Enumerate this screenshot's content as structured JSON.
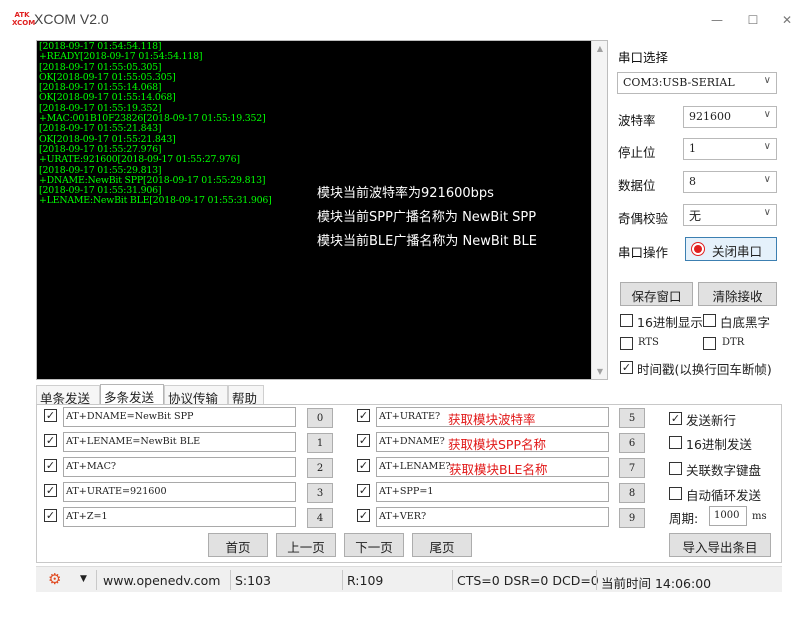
{
  "window": {
    "logo_text": "ATK\nXCOM",
    "title": "XCOM V2.0",
    "min_glyph": "—",
    "max_glyph": "☐",
    "close_glyph": "✕"
  },
  "terminal": {
    "lines": [
      "[2018-09-17 01:54:54.118]",
      "+READY[2018-09-17 01:54:54.118]",
      "[2018-09-17 01:55:05.305]",
      "OK[2018-09-17 01:55:05.305]",
      "[2018-09-17 01:55:14.068]",
      "OK[2018-09-17 01:55:14.068]",
      "[2018-09-17 01:55:19.352]",
      "+MAC:001B10F23826[2018-09-17 01:55:19.352]",
      "[2018-09-17 01:55:21.843]",
      "OK[2018-09-17 01:55:21.843]",
      "[2018-09-17 01:55:27.976]",
      "+URATE:921600[2018-09-17 01:55:27.976]",
      "[2018-09-17 01:55:29.813]",
      "+DNAME:NewBit SPP[2018-09-17 01:55:29.813]",
      "[2018-09-17 01:55:31.906]",
      "+LENAME:NewBit BLE[2018-09-17 01:55:31.906]"
    ],
    "annotations": [
      "模块当前波特率为921600bps",
      "模块当前SPP广播名称为 NewBit SPP",
      "模块当前BLE广播名称为 NewBit BLE"
    ],
    "scroll_up": "▲",
    "scroll_down": "▼"
  },
  "settings": {
    "port_label": "串口选择",
    "port_value": "COM3:USB-SERIAL",
    "baud_label": "波特率",
    "baud_value": "921600",
    "stop_label": "停止位",
    "stop_value": "1",
    "data_label": "数据位",
    "data_value": "8",
    "parity_label": "奇偶校验",
    "parity_value": "无",
    "op_label": "串口操作",
    "close_port_label": "关闭串口",
    "save_window_label": "保存窗口",
    "clear_recv_label": "清除接收",
    "hex_display_label": "16进制显示",
    "white_bg_label": "白底黑字",
    "rts_label": "RTS",
    "dtr_label": "DTR",
    "timestamp_label": "时间戳(以换行回车断帧)",
    "chevron": "∨",
    "checked": "✓",
    "unchecked": ""
  },
  "tabs": [
    "单条发送",
    "多条发送",
    "协议传输",
    "帮助"
  ],
  "multi_send": {
    "left": [
      {
        "text": "AT+DNAME=NewBit SPP",
        "num": "0"
      },
      {
        "text": "AT+LENAME=NewBit BLE",
        "num": "1"
      },
      {
        "text": "AT+MAC?",
        "num": "2"
      },
      {
        "text": "AT+URATE=921600",
        "num": "3"
      },
      {
        "text": "AT+Z=1",
        "num": "4"
      }
    ],
    "right": [
      {
        "text": "AT+URATE?",
        "note": "获取模块波特率",
        "num": "5"
      },
      {
        "text": "AT+DNAME?",
        "note": "获取模块SPP名称",
        "num": "6"
      },
      {
        "text": "AT+LENAME?",
        "note": "获取模块BLE名称",
        "num": "7"
      },
      {
        "text": "AT+SPP=1",
        "note": "",
        "num": "8"
      },
      {
        "text": "AT+VER?",
        "note": "",
        "num": "9"
      }
    ],
    "send_newline_label": "发送新行",
    "hex_send_label": "16进制发送",
    "numpad_label": "关联数字键盘",
    "auto_loop_label": "自动循环发送",
    "period_label": "周期:",
    "period_value": "1000",
    "period_unit": "ms",
    "first_page": "首页",
    "prev_page": "上一页",
    "next_page": "下一页",
    "last_page": "尾页",
    "import_export": "导入导出条目"
  },
  "status": {
    "gear_glyph": "⚙",
    "dropdown_glyph": "▼",
    "url": "www.openedv.com",
    "sent": "S:103",
    "received": "R:109",
    "lines": "CTS=0 DSR=0 DCD=0",
    "time": "当前时间 14:06:00"
  },
  "colors": {
    "terminal_bg": "#000000",
    "terminal_text": "#00ff00",
    "annotation_text": "#ffffff",
    "note_text": "#e11818",
    "port_open_indicator": "#e02020"
  }
}
